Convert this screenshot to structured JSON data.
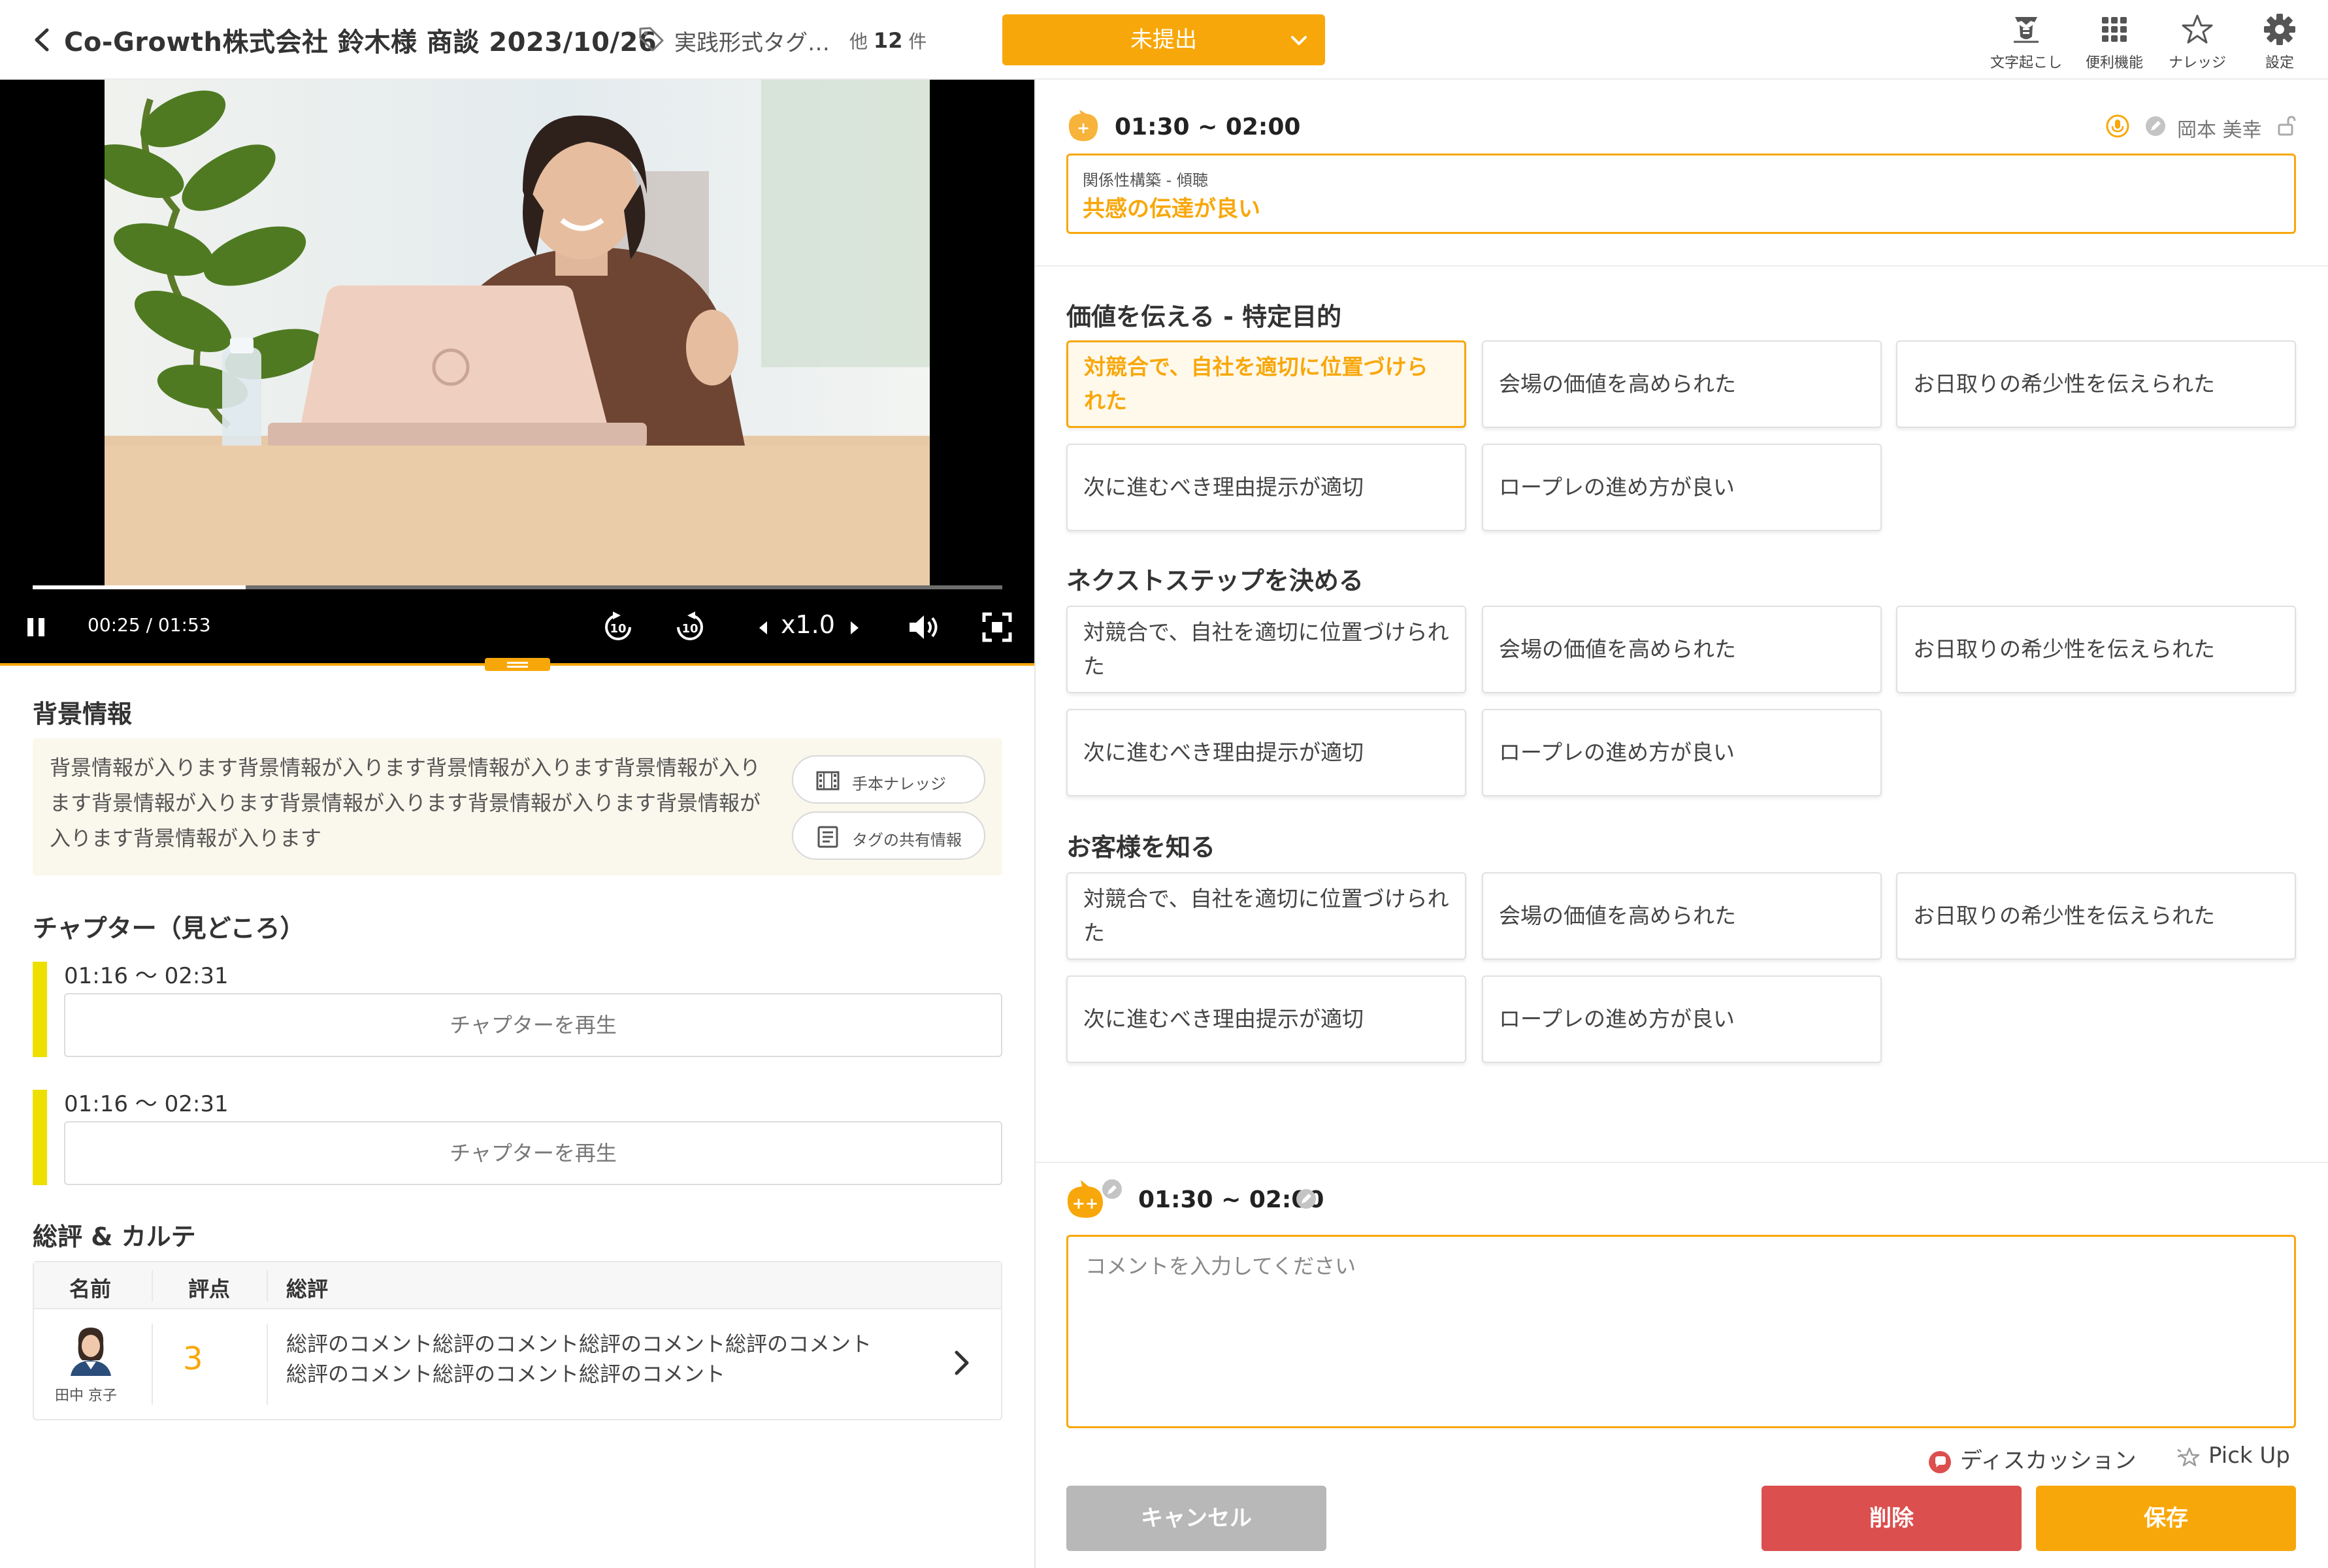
{
  "header": {
    "title": "Co-Growth株式会社 鈴木様 商談 2023/10/26",
    "tag_label": "実践形式タグ…",
    "tag_other_prefix": "他",
    "tag_other_count": "12",
    "tag_other_suffix": "件",
    "status": "未提出",
    "tools": [
      {
        "label": "文字起こし",
        "icon": "transcribe-icon"
      },
      {
        "label": "便利機能",
        "icon": "grid-icon"
      },
      {
        "label": "ナレッジ",
        "icon": "star-icon"
      },
      {
        "label": "設定",
        "icon": "gear-icon"
      }
    ]
  },
  "video": {
    "current_time": "00:25",
    "duration": "01:53",
    "time_display": "00:25 / 01:53",
    "speed": "x1.0",
    "progress": 0.22,
    "rewind_label": "10",
    "forward_label": "10"
  },
  "background": {
    "title": "背景情報",
    "text": "背景情報が入ります背景情報が入ります背景情報が入ります背景情報が入ります背景情報が入ります背景情報が入ります背景情報が入ります背景情報が入ります背景情報が入ります",
    "knowledge_button": "手本ナレッジ",
    "share_button": "タグの共有情報"
  },
  "chapters": {
    "title": "チャプター（見どころ）",
    "items": [
      {
        "time": "01:16 〜 02:31",
        "button": "チャプターを再生"
      },
      {
        "time": "01:16 〜 02:31",
        "button": "チャプターを再生"
      }
    ]
  },
  "review": {
    "title": "総評 & カルテ",
    "columns": [
      "名前",
      "評点",
      "総評"
    ],
    "rows": [
      {
        "name": "田中 京子",
        "score": "3",
        "comment_line1": "総評のコメント総評のコメント総評のコメント総評のコメント",
        "comment_line2": "総評のコメント総評のコメント総評のコメント"
      }
    ]
  },
  "segment": {
    "time": "01:30 ~ 02:00",
    "user": "岡本 美幸",
    "selected_category": "関係性構築 - 傾聴",
    "selected_tag": "共感の伝達が良い"
  },
  "tag_groups": [
    {
      "title": "価値を伝える - 特定目的",
      "tags": [
        "対競合で、自社を適切に位置づけられた",
        "会場の価値を高められた",
        "お日取りの希少性を伝えられた",
        "次に進むべき理由提示が適切",
        "ロープレの進め方が良い"
      ],
      "selected_index": 0
    },
    {
      "title": "ネクストステップを決める",
      "tags": [
        "対競合で、自社を適切に位置づけられた",
        "会場の価値を高められた",
        "お日取りの希少性を伝えられた",
        "次に進むべき理由提示が適切",
        "ロープレの進め方が良い"
      ],
      "selected_index": -1
    },
    {
      "title": "お客様を知る",
      "tags": [
        "対競合で、自社を適切に位置づけられた",
        "会場の価値を高められた",
        "お日取りの希少性を伝えられた",
        "次に進むべき理由提示が適切",
        "ロープレの進め方が良い"
      ],
      "selected_index": -1
    }
  ],
  "comment_form": {
    "badge": "++",
    "time": "01:30 ~ 02:00",
    "placeholder": "コメントを入力してください",
    "discussion_label": "ディスカッション",
    "pickup_label": "Pick Up",
    "cancel": "キャンセル",
    "delete": "削除",
    "save": "保存"
  },
  "colors": {
    "accent": "#f8a70a",
    "delete": "#dc4f4f",
    "cancel": "#b8b8b8",
    "chapter_bar": "#eddf00"
  }
}
